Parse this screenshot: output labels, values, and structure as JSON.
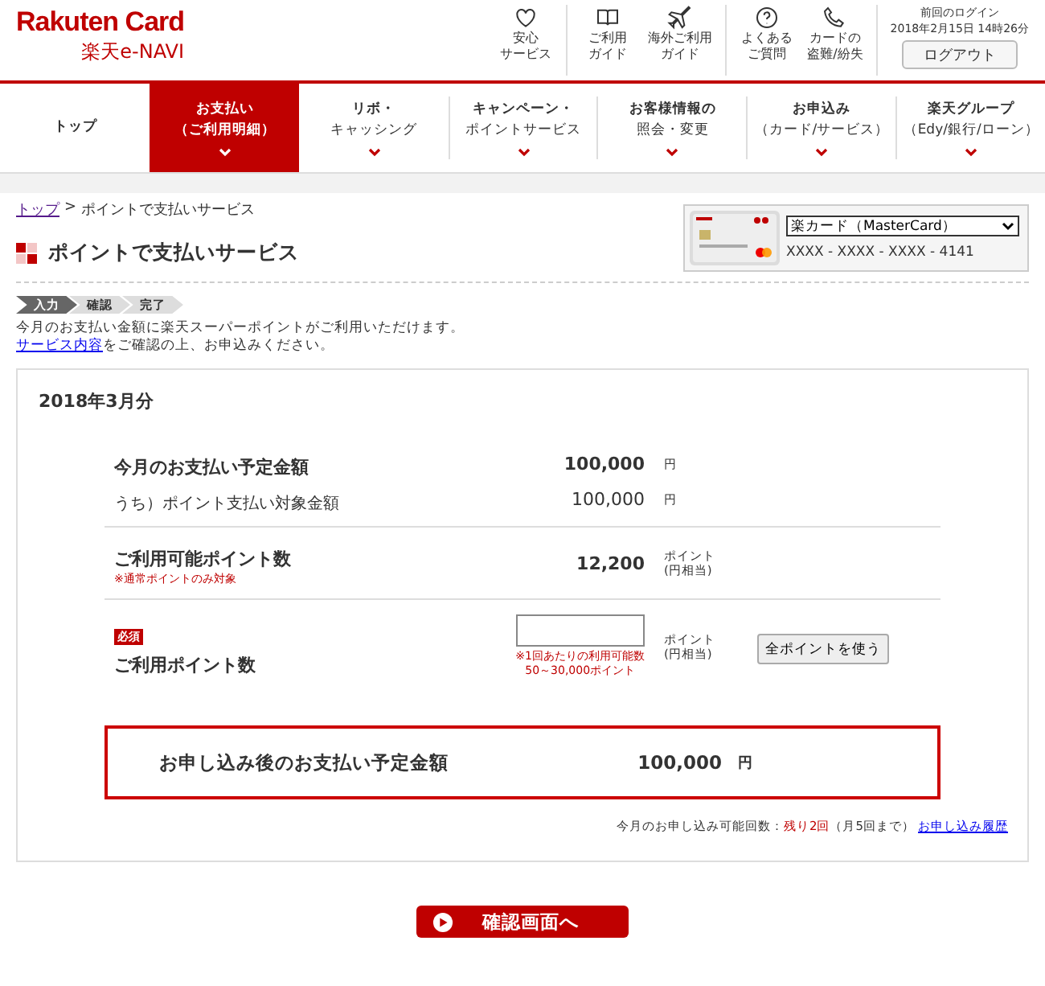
{
  "header": {
    "brand": "Rakuten Card",
    "subbrand": "楽天e-NAVI",
    "utility_groups": [
      [
        {
          "kind": "heart",
          "lines": [
            "安心",
            "サービス"
          ]
        }
      ],
      [
        {
          "kind": "book",
          "lines": [
            "ご利用",
            "ガイド"
          ]
        },
        {
          "kind": "plane",
          "lines": [
            "海外ご利用",
            "ガイド"
          ]
        }
      ],
      [
        {
          "kind": "question",
          "lines": [
            "よくある",
            "ご質問"
          ]
        },
        {
          "kind": "phone",
          "lines": [
            "カードの",
            "盗難/紛失"
          ]
        }
      ]
    ],
    "last_login_label": "前回のログイン",
    "last_login": "2018年2月15日 14時26分",
    "logout": "ログアウト"
  },
  "nav": [
    {
      "lines": [
        "トップ"
      ],
      "selected": false,
      "dropdown": false
    },
    {
      "lines": [
        "お支払い",
        "（ご利用明細）"
      ],
      "selected": true,
      "dropdown": true
    },
    {
      "lines": [
        "リボ・",
        "キャッシング"
      ],
      "selected": false,
      "dropdown": true
    },
    {
      "lines": [
        "キャンペーン・",
        "ポイントサービス"
      ],
      "selected": false,
      "dropdown": true
    },
    {
      "lines": [
        "お客様情報の",
        "照会・変更"
      ],
      "selected": false,
      "dropdown": true
    },
    {
      "lines": [
        "お申込み",
        "（カード/サービス）"
      ],
      "selected": false,
      "dropdown": true
    },
    {
      "lines": [
        "楽天グループ",
        "（Edy/銀行/ローン）"
      ],
      "selected": false,
      "dropdown": true
    }
  ],
  "breadcrumb": {
    "link": "トップ",
    "separator": ">",
    "current": "ポイントで支払いサービス"
  },
  "page_title": "ポイントで支払いサービス",
  "card_selector": {
    "selected": "楽カード（MasterCard）",
    "number": "XXXX - XXXX - XXXX - 4141"
  },
  "steps": [
    {
      "label": "入力",
      "selected": true
    },
    {
      "label": "確認",
      "selected": false
    },
    {
      "label": "完了",
      "selected": false
    }
  ],
  "intro": {
    "line1": "今月のお支払い金額に楽天スーパーポイントがご利用いただけます。",
    "link": "サービス内容",
    "line2_rest": "をご確認の上、お申込みください。"
  },
  "panel": {
    "month": "2018年3月分",
    "sections": [
      {
        "rows": [
          {
            "kind": "main",
            "label": "今月のお支払い予定金額",
            "value": "100,000",
            "unit": "円"
          },
          {
            "kind": "sub",
            "label": "うち）ポイント支払い対象金額",
            "value": "100,000",
            "unit": "円"
          }
        ]
      },
      {
        "rows": [
          {
            "kind": "main",
            "label": "ご利用可能ポイント数",
            "note": "※通常ポイントのみ対象",
            "value": "12,200",
            "unit_lines": [
              "ポイント",
              "(円相当)"
            ]
          }
        ]
      },
      {
        "rows": [
          {
            "kind": "input",
            "required": "必須",
            "label": "ご利用ポイント数",
            "hint_lines": [
              "※1回あたりの利用可能数",
              "50～30,000ポイント"
            ],
            "unit_lines": [
              "ポイント",
              "(円相当)"
            ],
            "button": "全ポイントを使う"
          }
        ]
      }
    ],
    "summary": {
      "label": "お申し込み後のお支払い予定金額",
      "value": "100,000",
      "unit": "円"
    },
    "remaining": {
      "prefix": "今月のお申し込み可能回数：",
      "count": "残り2回",
      "suffix": "（月5回まで）",
      "link": "お申し込み履歴"
    }
  },
  "submit": "確認画面へ"
}
